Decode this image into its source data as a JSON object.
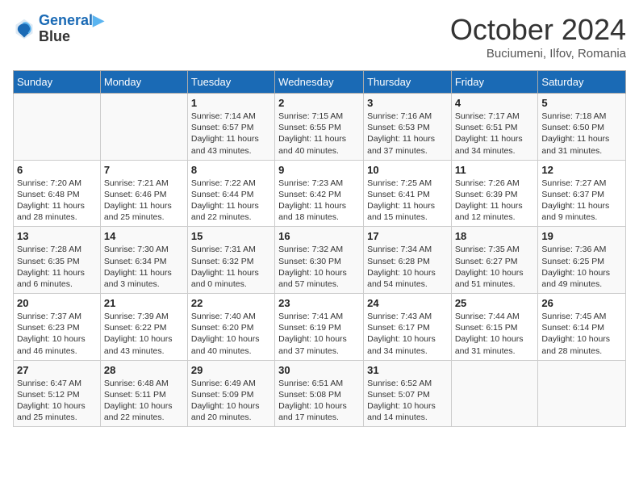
{
  "header": {
    "logo_line1": "General",
    "logo_line2": "Blue",
    "month_title": "October 2024",
    "location": "Buciumeni, Ilfov, Romania"
  },
  "weekdays": [
    "Sunday",
    "Monday",
    "Tuesday",
    "Wednesday",
    "Thursday",
    "Friday",
    "Saturday"
  ],
  "weeks": [
    [
      {
        "day": "",
        "info": ""
      },
      {
        "day": "",
        "info": ""
      },
      {
        "day": "1",
        "info": "Sunrise: 7:14 AM\nSunset: 6:57 PM\nDaylight: 11 hours and 43 minutes."
      },
      {
        "day": "2",
        "info": "Sunrise: 7:15 AM\nSunset: 6:55 PM\nDaylight: 11 hours and 40 minutes."
      },
      {
        "day": "3",
        "info": "Sunrise: 7:16 AM\nSunset: 6:53 PM\nDaylight: 11 hours and 37 minutes."
      },
      {
        "day": "4",
        "info": "Sunrise: 7:17 AM\nSunset: 6:51 PM\nDaylight: 11 hours and 34 minutes."
      },
      {
        "day": "5",
        "info": "Sunrise: 7:18 AM\nSunset: 6:50 PM\nDaylight: 11 hours and 31 minutes."
      }
    ],
    [
      {
        "day": "6",
        "info": "Sunrise: 7:20 AM\nSunset: 6:48 PM\nDaylight: 11 hours and 28 minutes."
      },
      {
        "day": "7",
        "info": "Sunrise: 7:21 AM\nSunset: 6:46 PM\nDaylight: 11 hours and 25 minutes."
      },
      {
        "day": "8",
        "info": "Sunrise: 7:22 AM\nSunset: 6:44 PM\nDaylight: 11 hours and 22 minutes."
      },
      {
        "day": "9",
        "info": "Sunrise: 7:23 AM\nSunset: 6:42 PM\nDaylight: 11 hours and 18 minutes."
      },
      {
        "day": "10",
        "info": "Sunrise: 7:25 AM\nSunset: 6:41 PM\nDaylight: 11 hours and 15 minutes."
      },
      {
        "day": "11",
        "info": "Sunrise: 7:26 AM\nSunset: 6:39 PM\nDaylight: 11 hours and 12 minutes."
      },
      {
        "day": "12",
        "info": "Sunrise: 7:27 AM\nSunset: 6:37 PM\nDaylight: 11 hours and 9 minutes."
      }
    ],
    [
      {
        "day": "13",
        "info": "Sunrise: 7:28 AM\nSunset: 6:35 PM\nDaylight: 11 hours and 6 minutes."
      },
      {
        "day": "14",
        "info": "Sunrise: 7:30 AM\nSunset: 6:34 PM\nDaylight: 11 hours and 3 minutes."
      },
      {
        "day": "15",
        "info": "Sunrise: 7:31 AM\nSunset: 6:32 PM\nDaylight: 11 hours and 0 minutes."
      },
      {
        "day": "16",
        "info": "Sunrise: 7:32 AM\nSunset: 6:30 PM\nDaylight: 10 hours and 57 minutes."
      },
      {
        "day": "17",
        "info": "Sunrise: 7:34 AM\nSunset: 6:28 PM\nDaylight: 10 hours and 54 minutes."
      },
      {
        "day": "18",
        "info": "Sunrise: 7:35 AM\nSunset: 6:27 PM\nDaylight: 10 hours and 51 minutes."
      },
      {
        "day": "19",
        "info": "Sunrise: 7:36 AM\nSunset: 6:25 PM\nDaylight: 10 hours and 49 minutes."
      }
    ],
    [
      {
        "day": "20",
        "info": "Sunrise: 7:37 AM\nSunset: 6:23 PM\nDaylight: 10 hours and 46 minutes."
      },
      {
        "day": "21",
        "info": "Sunrise: 7:39 AM\nSunset: 6:22 PM\nDaylight: 10 hours and 43 minutes."
      },
      {
        "day": "22",
        "info": "Sunrise: 7:40 AM\nSunset: 6:20 PM\nDaylight: 10 hours and 40 minutes."
      },
      {
        "day": "23",
        "info": "Sunrise: 7:41 AM\nSunset: 6:19 PM\nDaylight: 10 hours and 37 minutes."
      },
      {
        "day": "24",
        "info": "Sunrise: 7:43 AM\nSunset: 6:17 PM\nDaylight: 10 hours and 34 minutes."
      },
      {
        "day": "25",
        "info": "Sunrise: 7:44 AM\nSunset: 6:15 PM\nDaylight: 10 hours and 31 minutes."
      },
      {
        "day": "26",
        "info": "Sunrise: 7:45 AM\nSunset: 6:14 PM\nDaylight: 10 hours and 28 minutes."
      }
    ],
    [
      {
        "day": "27",
        "info": "Sunrise: 6:47 AM\nSunset: 5:12 PM\nDaylight: 10 hours and 25 minutes."
      },
      {
        "day": "28",
        "info": "Sunrise: 6:48 AM\nSunset: 5:11 PM\nDaylight: 10 hours and 22 minutes."
      },
      {
        "day": "29",
        "info": "Sunrise: 6:49 AM\nSunset: 5:09 PM\nDaylight: 10 hours and 20 minutes."
      },
      {
        "day": "30",
        "info": "Sunrise: 6:51 AM\nSunset: 5:08 PM\nDaylight: 10 hours and 17 minutes."
      },
      {
        "day": "31",
        "info": "Sunrise: 6:52 AM\nSunset: 5:07 PM\nDaylight: 10 hours and 14 minutes."
      },
      {
        "day": "",
        "info": ""
      },
      {
        "day": "",
        "info": ""
      }
    ]
  ]
}
